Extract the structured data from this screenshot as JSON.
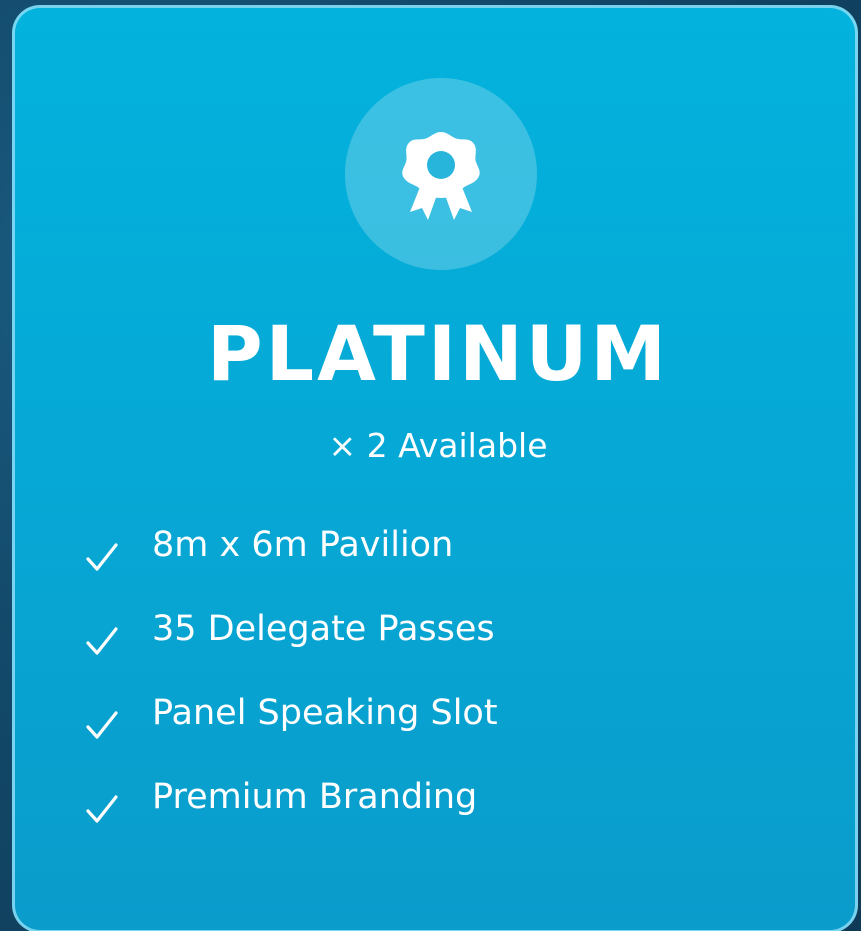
{
  "tier": {
    "icon": "award-ribbon-icon",
    "title": "PLATINUM",
    "availability": "× 2 Available",
    "features": [
      {
        "icon": "check-icon",
        "label": "8m x 6m Pavilion"
      },
      {
        "icon": "check-icon",
        "label": "35 Delegate Passes"
      },
      {
        "icon": "check-icon",
        "label": "Panel Speaking Slot"
      },
      {
        "icon": "check-icon",
        "label": "Premium Branding"
      }
    ]
  },
  "colors": {
    "card_background": "#06a9d6",
    "card_border": "#8cdcf5",
    "page_background": "#134a6b",
    "text": "#ffffff"
  }
}
